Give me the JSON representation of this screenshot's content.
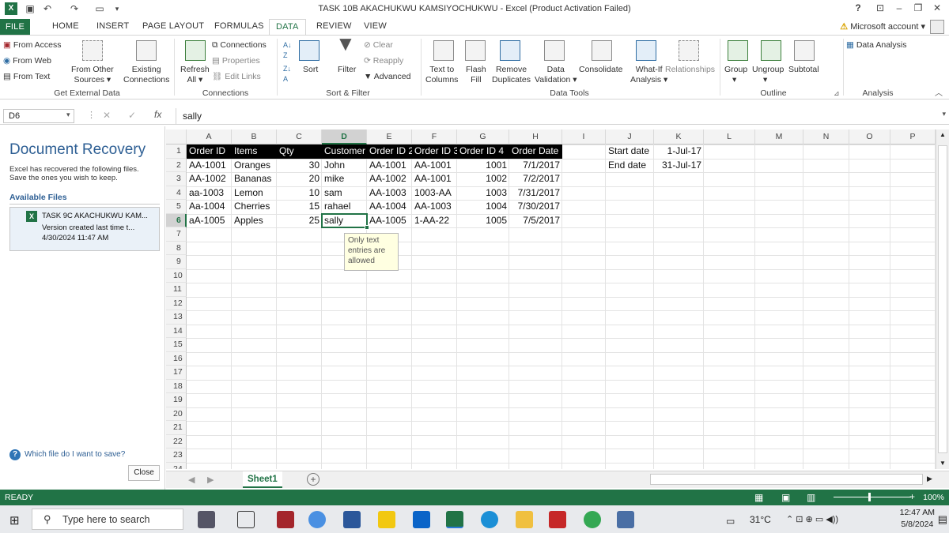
{
  "window": {
    "title": "TASK 10B AKACHUKWU KAMSIYOCHUKWU - Excel (Product Activation Failed)"
  },
  "tabs": [
    "FILE",
    "HOME",
    "INSERT",
    "PAGE LAYOUT",
    "FORMULAS",
    "DATA",
    "REVIEW",
    "VIEW"
  ],
  "account": {
    "label": "Microsoft account",
    "help": "?"
  },
  "ribbon": {
    "get_external": {
      "from_access": "From Access",
      "from_web": "From Web",
      "from_text": "From Text",
      "from_other_1": "From Other",
      "from_other_2": "Sources",
      "existing_1": "Existing",
      "existing_2": "Connections",
      "group": "Get External Data"
    },
    "connections": {
      "refresh_1": "Refresh",
      "refresh_2": "All",
      "connections": "Connections",
      "properties": "Properties",
      "edit_links": "Edit Links",
      "group": "Connections"
    },
    "sort_filter": {
      "sort": "Sort",
      "filter": "Filter",
      "clear": "Clear",
      "reapply": "Reapply",
      "advanced": "Advanced",
      "group": "Sort & Filter"
    },
    "data_tools": {
      "text_to_1": "Text to",
      "text_to_2": "Columns",
      "flash_1": "Flash",
      "flash_2": "Fill",
      "remove_1": "Remove",
      "remove_2": "Duplicates",
      "validation_1": "Data",
      "validation_2": "Validation",
      "consolidate": "Consolidate",
      "whatif_1": "What-If",
      "whatif_2": "Analysis",
      "relationships": "Relationships",
      "group": "Data Tools"
    },
    "outline": {
      "group_btn": "Group",
      "ungroup": "Ungroup",
      "subtotal": "Subtotal",
      "group": "Outline"
    },
    "analysis": {
      "data_analysis": "Data Analysis",
      "group": "Analysis"
    }
  },
  "formula_bar": {
    "name_box": "D6",
    "fx": "fx",
    "value": "sally"
  },
  "recovery": {
    "title": "Document Recovery",
    "line1": "Excel has recovered the following files.",
    "line2": "Save the ones you wish to keep.",
    "available": "Available Files",
    "file_name": "TASK 9C AKACHUKWU KAM...",
    "file_version": "Version created last time t...",
    "file_date": "4/30/2024 11:47 AM",
    "which": "Which file do I want to save?",
    "close": "Close"
  },
  "grid": {
    "columns": [
      "A",
      "B",
      "C",
      "D",
      "E",
      "F",
      "G",
      "H",
      "I",
      "J",
      "K",
      "L",
      "M",
      "N",
      "O",
      "P"
    ],
    "rows": [
      "1",
      "2",
      "3",
      "4",
      "5",
      "6",
      "7",
      "8",
      "9",
      "10",
      "11",
      "12",
      "13",
      "14",
      "15",
      "16",
      "17",
      "18",
      "19",
      "20",
      "21",
      "22",
      "23",
      "24"
    ],
    "headers": [
      "Order ID",
      "Items",
      "Qty",
      "Customer",
      "Order ID 2",
      "Order ID 3",
      "Order ID 4",
      "Order Date"
    ],
    "data": [
      [
        "AA-1001",
        "Oranges",
        "30",
        "John",
        "AA-1001",
        "AA-1001",
        "1001",
        "7/1/2017"
      ],
      [
        "AA-1002",
        "Bananas",
        "20",
        "mike",
        "AA-1002",
        "AA-1001",
        "1002",
        "7/2/2017"
      ],
      [
        "aa-1003",
        "Lemon",
        "10",
        "sam",
        "AA-1003",
        "1003-AA",
        "1003",
        "7/31/2017"
      ],
      [
        "Aa-1004",
        "Cherries",
        "15",
        "rahael",
        "AA-1004",
        "AA-1003",
        "1004",
        "7/30/2017"
      ],
      [
        "aA-1005",
        "Apples",
        "25",
        "sally",
        "AA-1005",
        "1-AA-22",
        "1005",
        "7/5/2017"
      ]
    ],
    "side": [
      [
        "Start date",
        "1-Jul-17"
      ],
      [
        "End date",
        "31-Jul-17"
      ]
    ],
    "tooltip": "Only text entries are allowed",
    "active_cell": "D6"
  },
  "sheet_tab": "Sheet1",
  "status": {
    "mode": "READY",
    "zoom": "100%"
  },
  "taskbar": {
    "search": "Type here to search",
    "temp": "31°C",
    "time": "12:47 AM",
    "date": "5/8/2024"
  },
  "colors": {
    "excel_green": "#217346",
    "header_fill": "#000000",
    "recovery_blue": "#2e5f94"
  }
}
